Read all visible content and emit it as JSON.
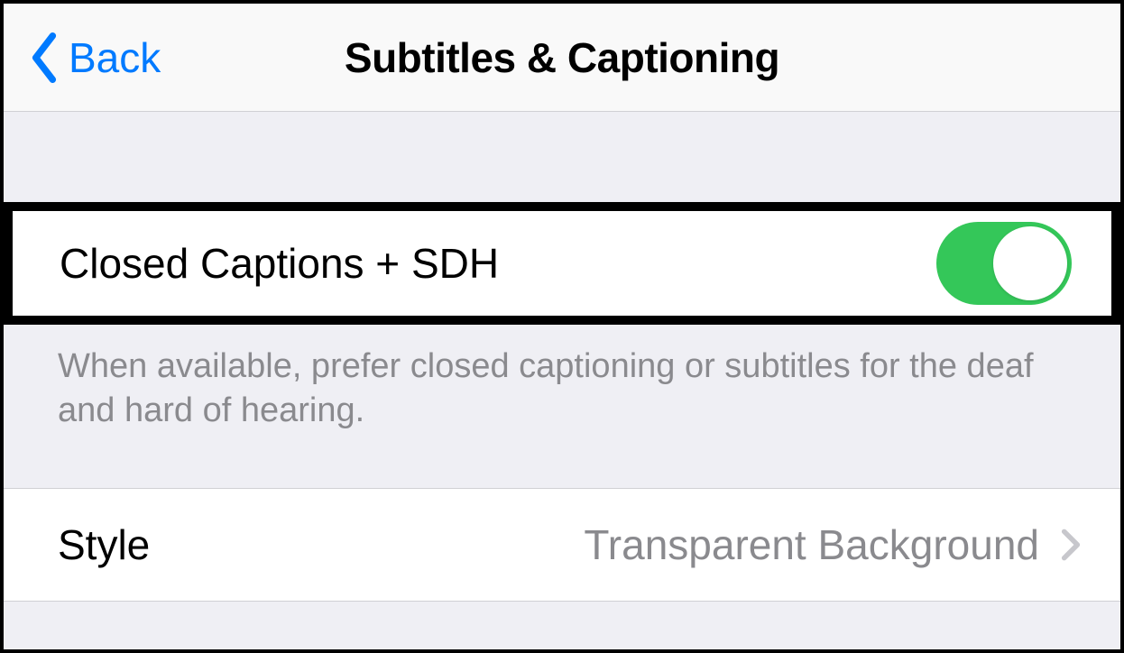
{
  "nav": {
    "back_label": "Back",
    "title": "Subtitles & Captioning"
  },
  "rows": {
    "closed_captions": {
      "label": "Closed Captions + SDH",
      "enabled": true,
      "footer": "When available, prefer closed captioning or subtitles for the deaf and hard of hearing."
    },
    "style": {
      "label": "Style",
      "value": "Transparent Background"
    }
  },
  "colors": {
    "tint": "#007aff",
    "toggle_on": "#34c759"
  }
}
